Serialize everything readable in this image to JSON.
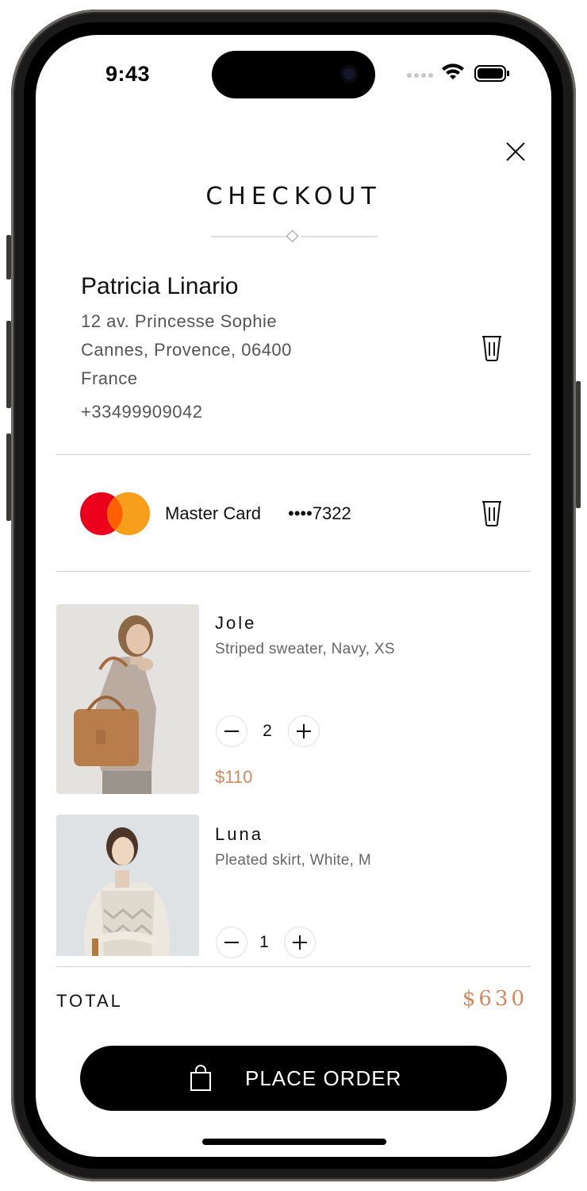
{
  "status_bar": {
    "time": "9:43"
  },
  "header": {
    "title": "CHECKOUT",
    "close_icon": "close-icon"
  },
  "address": {
    "name": "Patricia Linario",
    "line1": "12 av. Princesse Sophie",
    "line2": "Cannes, Provence, 06400",
    "country": "France",
    "phone": "+33499909042"
  },
  "payment": {
    "card_name": "Master Card",
    "card_number": "••••7322",
    "brand_colors": [
      "#eb001b",
      "#f79e1b",
      "#ff5f00"
    ]
  },
  "items": [
    {
      "name": "Jole",
      "description": "Striped sweater, Navy, XS",
      "quantity": "2",
      "price": "$110"
    },
    {
      "name": "Luna",
      "description": "Pleated skirt, White, M",
      "quantity": "1"
    }
  ],
  "summary": {
    "total_label": "TOTAL",
    "total_value": "$630"
  },
  "actions": {
    "place_order_label": "PLACE ORDER"
  },
  "colors": {
    "accent": "#d4875b",
    "button": "#000000"
  }
}
